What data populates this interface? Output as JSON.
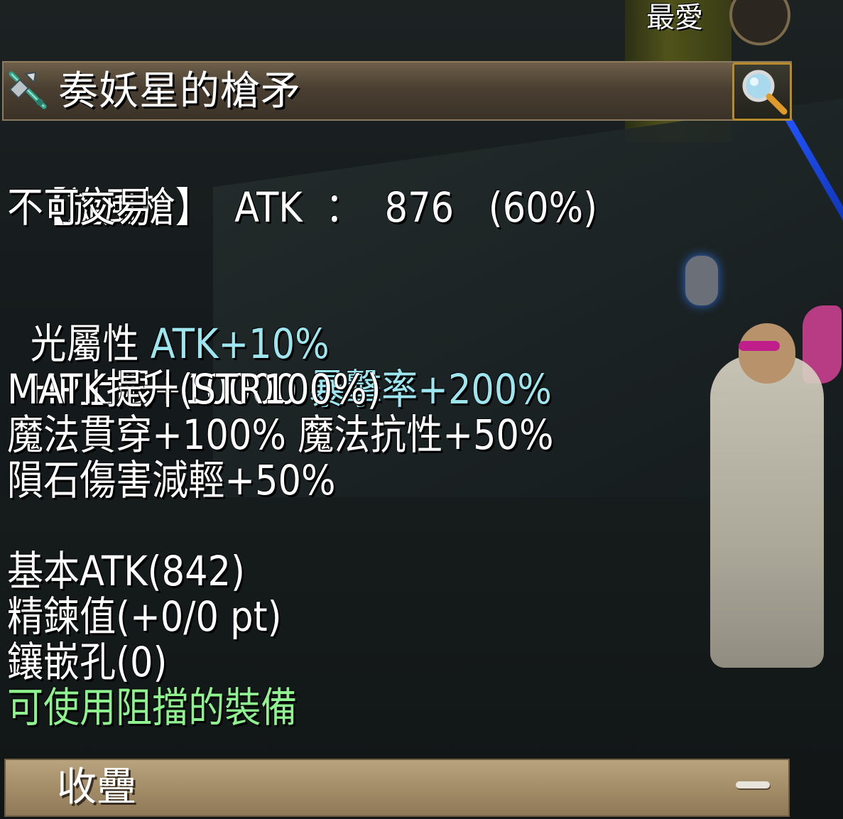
{
  "favorite": {
    "label": "最愛"
  },
  "item": {
    "name": "奏妖星的槍矛"
  },
  "stats": {
    "line1": {
      "type": "【旋風槍】",
      "atk_label": "ATK",
      "colon": "：",
      "atk_value": "876",
      "percent": "(60%)"
    },
    "line2": "不可交易",
    "line3": {
      "white": "光屬性 ",
      "cyan": "ATK+10%"
    },
    "line4": {
      "white": "HP上限+10000 ",
      "cyan": "暴擊率+200%"
    },
    "line5": "MATK提升(STR100%)",
    "line6": "魔法貫穿+100% 魔法抗性+50%",
    "line7": "隕石傷害減輕+50%",
    "line8": "基本ATK(842)",
    "line9": "精鍊值(+0/0 pt)",
    "line10": "鑲嵌孔(0)",
    "line11": "可使用阻擋的裝備"
  },
  "footer": {
    "collapse_label": "收疊"
  },
  "icons": {
    "weapon": "spear-weapon-icon",
    "search": "magnifier-icon",
    "collapse": "minus-icon"
  },
  "colors": {
    "text": "#ffffff",
    "highlight_cyan": "#9de6f0",
    "highlight_green": "#8ef28e",
    "title_bar": "#4a3f31",
    "collapse_bar": "#a48d69",
    "search_border": "#b78a2a"
  }
}
